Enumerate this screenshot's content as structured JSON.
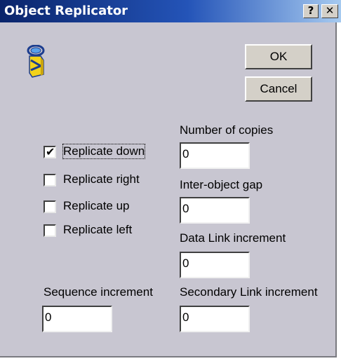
{
  "window": {
    "title": "Object Replicator",
    "help_glyph": "?",
    "close_glyph": "✕"
  },
  "icon": "object-replicator-icon",
  "buttons": {
    "ok_label": "OK",
    "cancel_label": "Cancel"
  },
  "options": [
    {
      "label": "Replicate down",
      "checked": true
    },
    {
      "label": "Replicate right",
      "checked": false
    },
    {
      "label": "Replicate up",
      "checked": false
    },
    {
      "label": "Replicate left",
      "checked": false
    }
  ],
  "fields": {
    "number_of_copies": {
      "label": "Number of copies",
      "value": "0"
    },
    "inter_object_gap": {
      "label": "Inter-object gap",
      "value": "0"
    },
    "data_link_increment": {
      "label": "Data Link increment",
      "value": "0"
    },
    "sequence_increment": {
      "label": "Sequence increment",
      "value": "0"
    },
    "secondary_link_increment": {
      "label": "Secondary Link increment",
      "value": "0"
    }
  },
  "checkmark_glyph": "✔"
}
